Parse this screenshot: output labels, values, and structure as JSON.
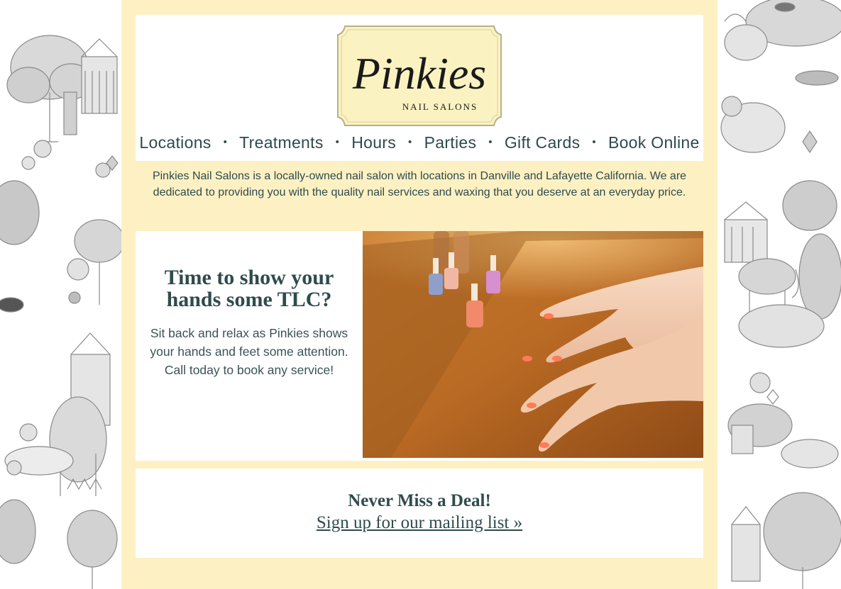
{
  "brand": {
    "logo_script": "Pinkies",
    "logo_sub": "NAIL SALONS"
  },
  "nav": {
    "items": [
      {
        "label": "Locations"
      },
      {
        "label": "Treatments"
      },
      {
        "label": "Hours"
      },
      {
        "label": "Parties"
      },
      {
        "label": "Gift Cards"
      },
      {
        "label": "Book Online"
      }
    ],
    "separator": "•"
  },
  "intro": {
    "text": "Pinkies Nail Salons is a locally-owned nail salon with locations in Danville and Lafayette California. We are dedicated to providing you with the quality nail services and waxing that you deserve at an everyday price."
  },
  "promo": {
    "title": "Time to show your hands some TLC?",
    "body": "Sit back and relax as Pinkies shows your hands and feet some attention. Call today to book any service!"
  },
  "deal": {
    "title": "Never Miss a Deal!",
    "link": "Sign up for our mailing list »"
  },
  "colors": {
    "cream": "#fdf1c4",
    "teal_text": "#2e4a4c",
    "logo_bg": "#fbf2c2"
  }
}
